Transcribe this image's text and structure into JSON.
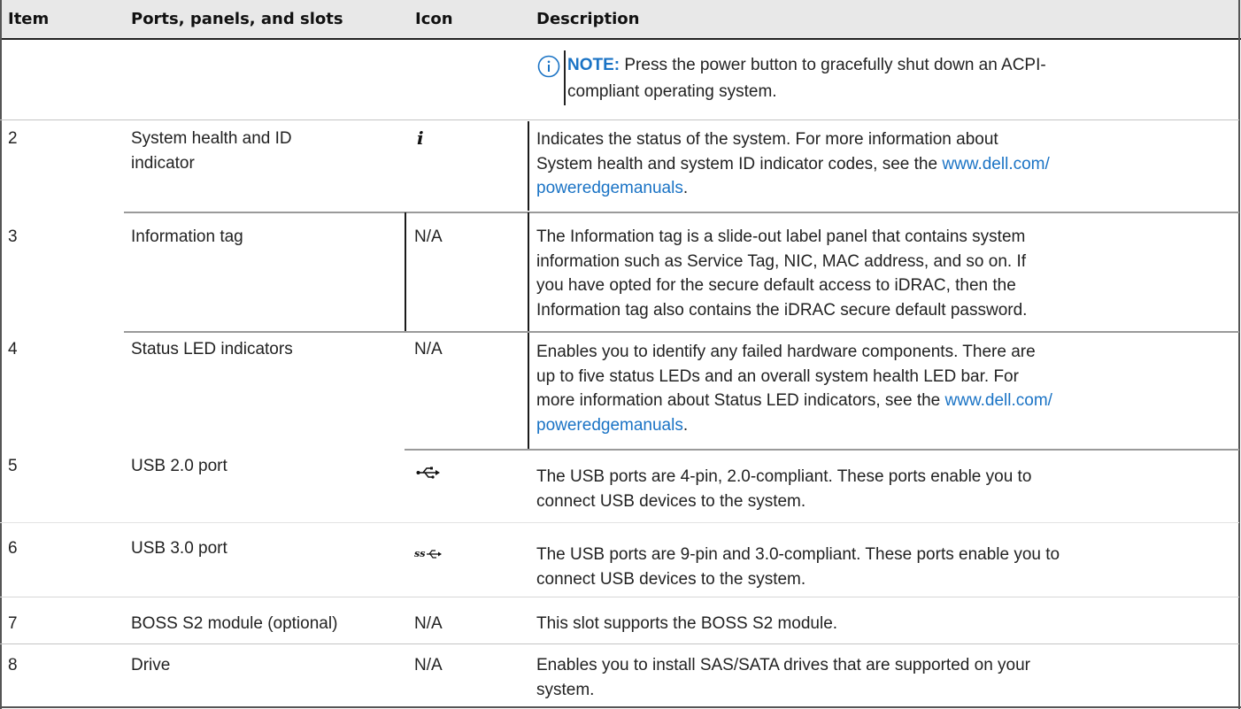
{
  "header": {
    "item": "Item",
    "ports": "Ports, panels, and slots",
    "icon": "Icon",
    "description": "Description"
  },
  "note": {
    "label": "NOTE:",
    "line1": " Press the power button to gracefully shut down an ACPI-",
    "line2": "compliant operating system."
  },
  "rows": [
    {
      "item": "2",
      "name": [
        "System health and ID",
        "indicator"
      ],
      "icon_text": "",
      "icon_name": "system-health-i-icon",
      "desc": [
        "Indicates the status of the system. For more information about",
        "System health and system ID indicator codes, see the "
      ],
      "link_a": "www.dell.com/",
      "link_b": "poweredgemanuals",
      "after": "."
    },
    {
      "item": "3",
      "name": [
        "Information tag"
      ],
      "icon_text": "N/A",
      "desc": [
        "The Information tag is a slide-out label panel that contains system",
        "information such as Service Tag, NIC, MAC address, and so on. If",
        "you have opted for the secure default access to iDRAC, then the",
        "Information tag also contains the iDRAC secure default password."
      ]
    },
    {
      "item": "4",
      "name": [
        "Status LED indicators"
      ],
      "icon_text": "N/A",
      "desc": [
        "Enables you to identify any failed hardware components. There are",
        "up to five status LEDs and an overall system health LED bar. For",
        "more information about Status LED indicators, see the "
      ],
      "link_a": "www.dell.com/",
      "link_b": "poweredgemanuals",
      "after": "."
    },
    {
      "item": "5",
      "name": [
        "USB 2.0 port"
      ],
      "icon_name": "usb-icon",
      "desc": [
        "The USB ports are 4-pin, 2.0-compliant. These ports enable you to",
        "connect USB devices to the system."
      ]
    },
    {
      "item": "6",
      "name": [
        "USB 3.0 port"
      ],
      "icon_name": "usb-superspeed-icon",
      "desc": [
        "The USB ports are 9-pin and 3.0-compliant. These ports enable you to",
        "connect USB devices to the system."
      ]
    },
    {
      "item": "7",
      "name": [
        "BOSS S2 module (optional)"
      ],
      "icon_text": "N/A",
      "desc": [
        "This slot supports the BOSS S2 module."
      ]
    },
    {
      "item": "8",
      "name": [
        "Drive"
      ],
      "icon_text": "N/A",
      "desc": [
        "Enables you to install SAS/SATA drives that are supported on your",
        "system."
      ]
    }
  ]
}
